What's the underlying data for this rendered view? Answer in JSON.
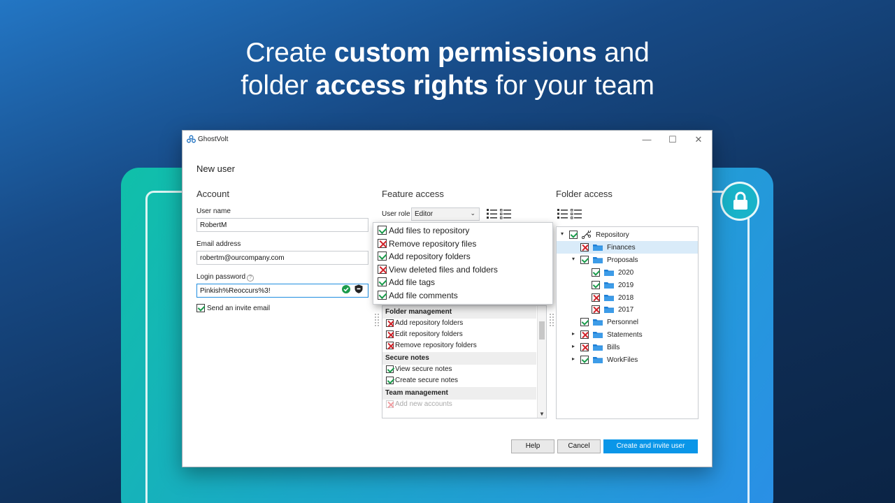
{
  "headline": {
    "line1_normal_a": "Create ",
    "line1_bold": "custom permissions",
    "line1_normal_b": " and",
    "line2_normal_a": "folder ",
    "line2_bold": "access rights",
    "line2_normal_b": " for your team"
  },
  "window": {
    "app_name": "GhostVolt",
    "controls": {
      "minimize": "—",
      "maximize": "☐",
      "close": "✕"
    }
  },
  "dialog": {
    "title": "New user",
    "account": {
      "heading": "Account",
      "username_label": "User name",
      "username_value": "RobertM",
      "email_label": "Email address",
      "email_value": "robertm@ourcompany.com",
      "password_label": "Login password",
      "password_help": "?",
      "password_value": "Pinkish%Reoccurs%3!",
      "invite_label": "Send an invite email",
      "invite_checked": true
    },
    "feature_access": {
      "heading": "Feature access",
      "user_role_label": "User role",
      "user_role_value": "Editor",
      "popup_items": [
        {
          "label": "Add files to repository",
          "state": "ok"
        },
        {
          "label": "Remove repository files",
          "state": "no"
        },
        {
          "label": "Add repository folders",
          "state": "ok"
        },
        {
          "label": "View deleted files and folders",
          "state": "no"
        },
        {
          "label": "Add file tags",
          "state": "ok"
        },
        {
          "label": "Add file comments",
          "state": "ok"
        }
      ],
      "groups": [
        {
          "title": "Folder management",
          "items": [
            {
              "label": "Add repository folders",
              "state": "no"
            },
            {
              "label": "Edit repository folders",
              "state": "no"
            },
            {
              "label": "Remove repository folders",
              "state": "no"
            }
          ]
        },
        {
          "title": "Secure notes",
          "items": [
            {
              "label": "View secure notes",
              "state": "ok"
            },
            {
              "label": "Create secure notes",
              "state": "ok"
            }
          ]
        },
        {
          "title": "Team management",
          "items": [
            {
              "label": "Add new accounts",
              "state": "faded"
            }
          ]
        }
      ]
    },
    "folder_access": {
      "heading": "Folder access",
      "tree": [
        {
          "label": "Repository",
          "state": "ok",
          "expander": "▾",
          "icon": "repository-icon",
          "level": 0
        },
        {
          "label": "Finances",
          "state": "no",
          "expander": "",
          "icon": "folder-icon",
          "level": 1,
          "selected": true
        },
        {
          "label": "Proposals",
          "state": "ok",
          "expander": "▾",
          "icon": "folder-icon",
          "level": 1
        },
        {
          "label": "2020",
          "state": "ok",
          "expander": "",
          "icon": "folder-icon",
          "level": 2
        },
        {
          "label": "2019",
          "state": "ok",
          "expander": "",
          "icon": "folder-icon",
          "level": 2
        },
        {
          "label": "2018",
          "state": "no",
          "expander": "",
          "icon": "folder-icon",
          "level": 2
        },
        {
          "label": "2017",
          "state": "no",
          "expander": "",
          "icon": "folder-icon",
          "level": 2
        },
        {
          "label": "Personnel",
          "state": "ok",
          "expander": "",
          "icon": "folder-icon",
          "level": 1
        },
        {
          "label": "Statements",
          "state": "no",
          "expander": "▸",
          "icon": "folder-icon",
          "level": 1
        },
        {
          "label": "Bills",
          "state": "no",
          "expander": "▸",
          "icon": "folder-icon",
          "level": 1
        },
        {
          "label": "WorkFiles",
          "state": "ok",
          "expander": "▸",
          "icon": "folder-icon",
          "level": 1
        }
      ]
    },
    "buttons": {
      "help": "Help",
      "cancel": "Cancel",
      "create": "Create and invite user"
    }
  },
  "colors": {
    "accent": "#0a96e8",
    "ok": "#1a9b4b",
    "deny": "#d1232a",
    "folder": "#1e7fd6",
    "selected_row": "#d9ebf9"
  }
}
